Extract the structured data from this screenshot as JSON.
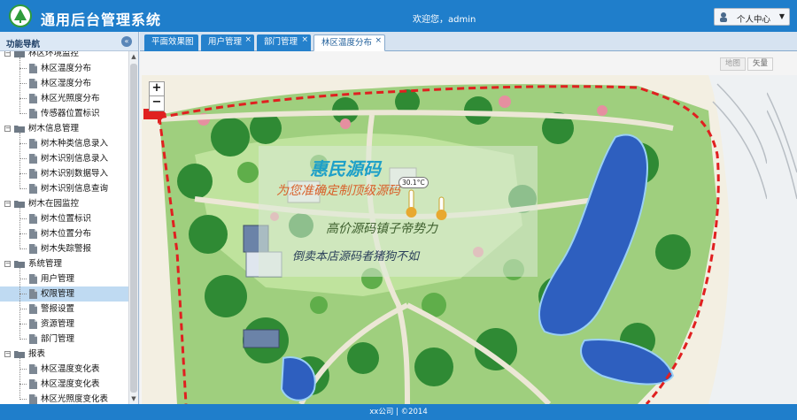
{
  "header": {
    "app_title": "通用后台管理系统",
    "welcome": "欢迎您，admin",
    "user_menu_label": "个人中心",
    "accent_color": "#1f7ecb"
  },
  "sidebar": {
    "title": "功能导航",
    "items": [
      {
        "label": "林区环境监控",
        "type": "folder"
      },
      {
        "label": "林区温度分布",
        "type": "leaf"
      },
      {
        "label": "林区湿度分布",
        "type": "leaf"
      },
      {
        "label": "林区光照度分布",
        "type": "leaf"
      },
      {
        "label": "传感器位置标识",
        "type": "leaf"
      },
      {
        "label": "树木信息管理",
        "type": "folder"
      },
      {
        "label": "树木种类信息录入",
        "type": "leaf"
      },
      {
        "label": "树木识别信息录入",
        "type": "leaf"
      },
      {
        "label": "树木识别数据导入",
        "type": "leaf"
      },
      {
        "label": "树木识别信息查询",
        "type": "leaf"
      },
      {
        "label": "树木在园监控",
        "type": "folder"
      },
      {
        "label": "树木位置标识",
        "type": "leaf"
      },
      {
        "label": "树木位置分布",
        "type": "leaf"
      },
      {
        "label": "树木失踪警报",
        "type": "leaf"
      },
      {
        "label": "系统管理",
        "type": "folder"
      },
      {
        "label": "用户管理",
        "type": "leaf"
      },
      {
        "label": "权限管理",
        "type": "leaf",
        "selected": true
      },
      {
        "label": "警报设置",
        "type": "leaf"
      },
      {
        "label": "资源管理",
        "type": "leaf"
      },
      {
        "label": "部门管理",
        "type": "leaf"
      },
      {
        "label": "报表",
        "type": "folder"
      },
      {
        "label": "林区温度变化表",
        "type": "leaf"
      },
      {
        "label": "林区湿度变化表",
        "type": "leaf"
      },
      {
        "label": "林区光照度变化表",
        "type": "leaf"
      }
    ]
  },
  "tabs": [
    {
      "label": "平面效果图",
      "closable": false,
      "active": false
    },
    {
      "label": "用户管理",
      "closable": true,
      "active": false
    },
    {
      "label": "部门管理",
      "closable": true,
      "active": false
    },
    {
      "label": "林区温度分布",
      "closable": true,
      "active": true
    }
  ],
  "map": {
    "map_type_map": "地图",
    "map_type_vector": "矢量",
    "zoom_in": "+",
    "zoom_out": "−",
    "temperature_reading": "30.1°C",
    "watermark": {
      "brand": "惠民源码",
      "line1": "为您准确定制顶级源码",
      "line2": "高价源码镇子帝势力",
      "line3": "倒卖本店源码者猪狗不如"
    }
  },
  "footer": {
    "text": "xx公司 | ©2014"
  },
  "colors": {
    "tab_active_text": "#1f5e9a",
    "selected_row": "#bfdaf2",
    "boundary_red": "#e02020",
    "water": "#2e5fbf"
  }
}
